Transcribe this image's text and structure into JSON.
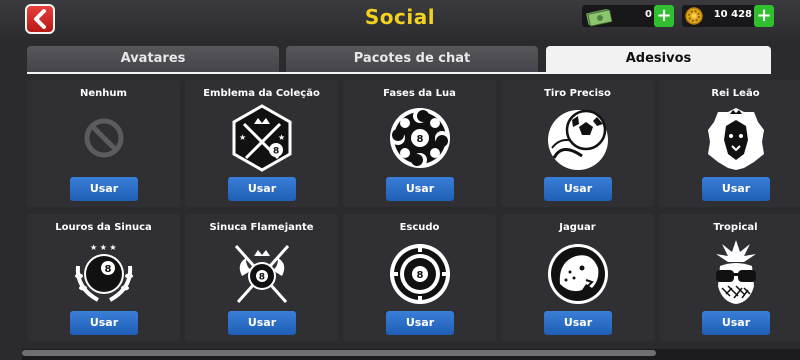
{
  "header": {
    "title": "Social",
    "cash": "0",
    "coins": "10 428",
    "plus_label": "+"
  },
  "tabs": [
    {
      "label": "Avatares",
      "active": false
    },
    {
      "label": "Pacotes de chat",
      "active": false
    },
    {
      "label": "Adesivos",
      "active": true
    }
  ],
  "stickers": [
    {
      "name": "Nenhum",
      "icon": "no-sticker-icon",
      "button": "Usar"
    },
    {
      "name": "Emblema da Coleção",
      "icon": "collection-emblem-icon",
      "button": "Usar"
    },
    {
      "name": "Fases da Lua",
      "icon": "moon-phases-icon",
      "button": "Usar"
    },
    {
      "name": "Tiro Preciso",
      "icon": "soccer-ball-icon",
      "button": "Usar"
    },
    {
      "name": "Rei Leão",
      "icon": "lion-icon",
      "button": "Usar"
    },
    {
      "name": "Louros da Sinuca",
      "icon": "laurel-8-ball-icon",
      "button": "Usar"
    },
    {
      "name": "Sinuca Flamejante",
      "icon": "flaming-8-ball-icon",
      "button": "Usar"
    },
    {
      "name": "Escudo",
      "icon": "shield-target-icon",
      "button": "Usar"
    },
    {
      "name": "Jaguar",
      "icon": "jaguar-icon",
      "button": "Usar"
    },
    {
      "name": "Tropical",
      "icon": "pineapple-icon",
      "button": "Usar"
    }
  ],
  "colors": {
    "title": "#f3d21f",
    "use_button": "#2a6fcb",
    "plus_button": "#2fbf2f",
    "back_button": "#d8302a"
  }
}
